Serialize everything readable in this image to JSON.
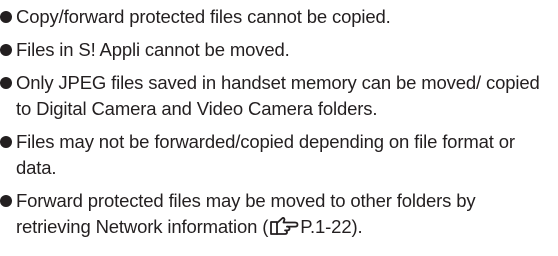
{
  "notes": [
    "Copy/forward protected files cannot be copied.",
    "Files in S! Appli cannot be moved.",
    "Only JPEG files saved in handset memory can be moved/ copied to Digital Camera and Video Camera folders.",
    "Files may not be forwarded/copied depending on file format or data.",
    {
      "before": "Forward protected files may be moved to other folders by retrieving Network information (",
      "icon": "pointing-hand-reference-icon",
      "ref": "P.1-22",
      "after": ")."
    }
  ]
}
